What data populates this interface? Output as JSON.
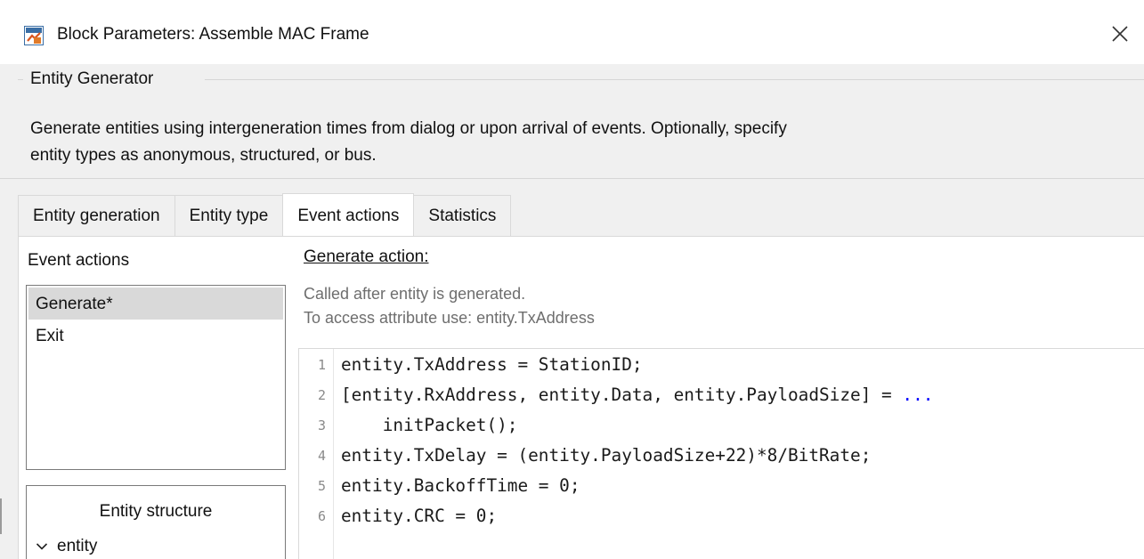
{
  "window": {
    "title": "Block Parameters: Assemble MAC Frame"
  },
  "group": {
    "legend": "Entity Generator",
    "description_line1": "Generate entities using intergeneration times from dialog or upon arrival of events. Optionally, specify",
    "description_line2": "entity types as anonymous, structured, or bus."
  },
  "tabs": [
    {
      "label": "Entity generation",
      "active": false
    },
    {
      "label": "Entity type",
      "active": false
    },
    {
      "label": "Event actions",
      "active": true
    },
    {
      "label": "Statistics",
      "active": false
    }
  ],
  "event_actions": {
    "heading": "Event actions",
    "items": [
      {
        "label": "Generate*",
        "selected": true
      },
      {
        "label": "Exit",
        "selected": false
      }
    ]
  },
  "entity_structure": {
    "title": "Entity structure",
    "root": "entity"
  },
  "generate_action": {
    "heading": "Generate action:",
    "note_line1": "Called after entity is generated.",
    "note_line2": "To access attribute use: entity.TxAddress"
  },
  "code": {
    "lines": [
      {
        "num": "1",
        "text": "entity.TxAddress = StationID;",
        "cont": ""
      },
      {
        "num": "2",
        "text": "[entity.RxAddress, entity.Data, entity.PayloadSize] = ",
        "cont": "..."
      },
      {
        "num": "3",
        "text": "    initPacket();",
        "cont": ""
      },
      {
        "num": "4",
        "text": "entity.TxDelay = (entity.PayloadSize+22)*8/BitRate;",
        "cont": ""
      },
      {
        "num": "5",
        "text": "entity.BackoffTime = 0;",
        "cont": ""
      },
      {
        "num": "6",
        "text": "entity.CRC = 0;",
        "cont": ""
      }
    ]
  },
  "colors": {
    "window_bg": "#f0f0f0",
    "selection": "#d9d9d9",
    "continuation": "#0000ff",
    "note_text": "#6e6e6e"
  },
  "icons": {
    "title": "simulink-block-icon",
    "close": "close-icon",
    "expand": "chevron-down-icon"
  }
}
